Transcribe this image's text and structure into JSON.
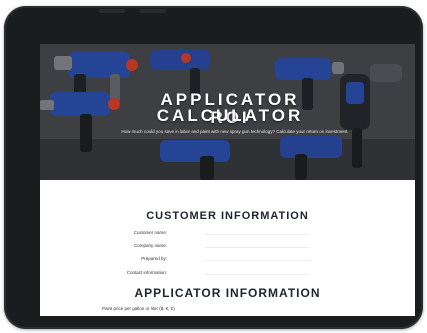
{
  "hero": {
    "title_line1": "APPLICATOR ROI",
    "title_line2": "CALCULATOR",
    "subtitle": "How much could you save in labor and paint with new spray gun technology? Calculate your return on investment."
  },
  "customer": {
    "title": "CUSTOMER INFORMATION",
    "fields": [
      {
        "label": "Customer name:",
        "value": ""
      },
      {
        "label": "Company name:",
        "value": ""
      },
      {
        "label": "Prepared by:",
        "value": ""
      },
      {
        "label": "Contact information:",
        "value": ""
      }
    ]
  },
  "applicator": {
    "title": "APPLICATOR INFORMATION",
    "field_label": "Paint price per gallon or liter ($, €, £)"
  },
  "colors": {
    "bezel": "#1b1c1e",
    "title_text": "#1f2430",
    "gun_body": "#2f53b8",
    "gun_accent": "#e0442c"
  },
  "icons": [
    "spray-gun-icon"
  ]
}
